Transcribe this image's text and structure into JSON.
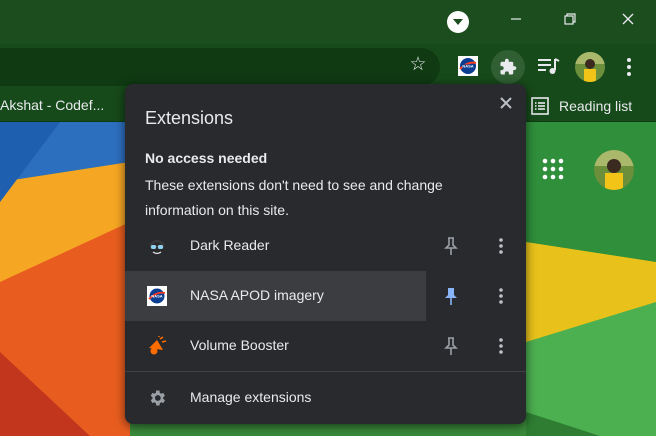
{
  "bookmarks": {
    "item": "Akshat - Codef...",
    "reading_list": "Reading list"
  },
  "popup": {
    "title": "Extensions",
    "section_heading": "No access needed",
    "section_description": "These extensions don't need to see and change information on this site.",
    "extensions": [
      {
        "name": "Dark Reader",
        "icon": "dark-reader-icon",
        "pinned": false
      },
      {
        "name": "NASA APOD imagery",
        "icon": "nasa-icon",
        "pinned": true
      },
      {
        "name": "Volume Booster",
        "icon": "volume-booster-icon",
        "pinned": false
      }
    ],
    "manage": "Manage extensions"
  },
  "colors": {
    "popup_bg": "#292a2d",
    "pin_active": "#8ab4f8",
    "text": "#e8eaed"
  }
}
